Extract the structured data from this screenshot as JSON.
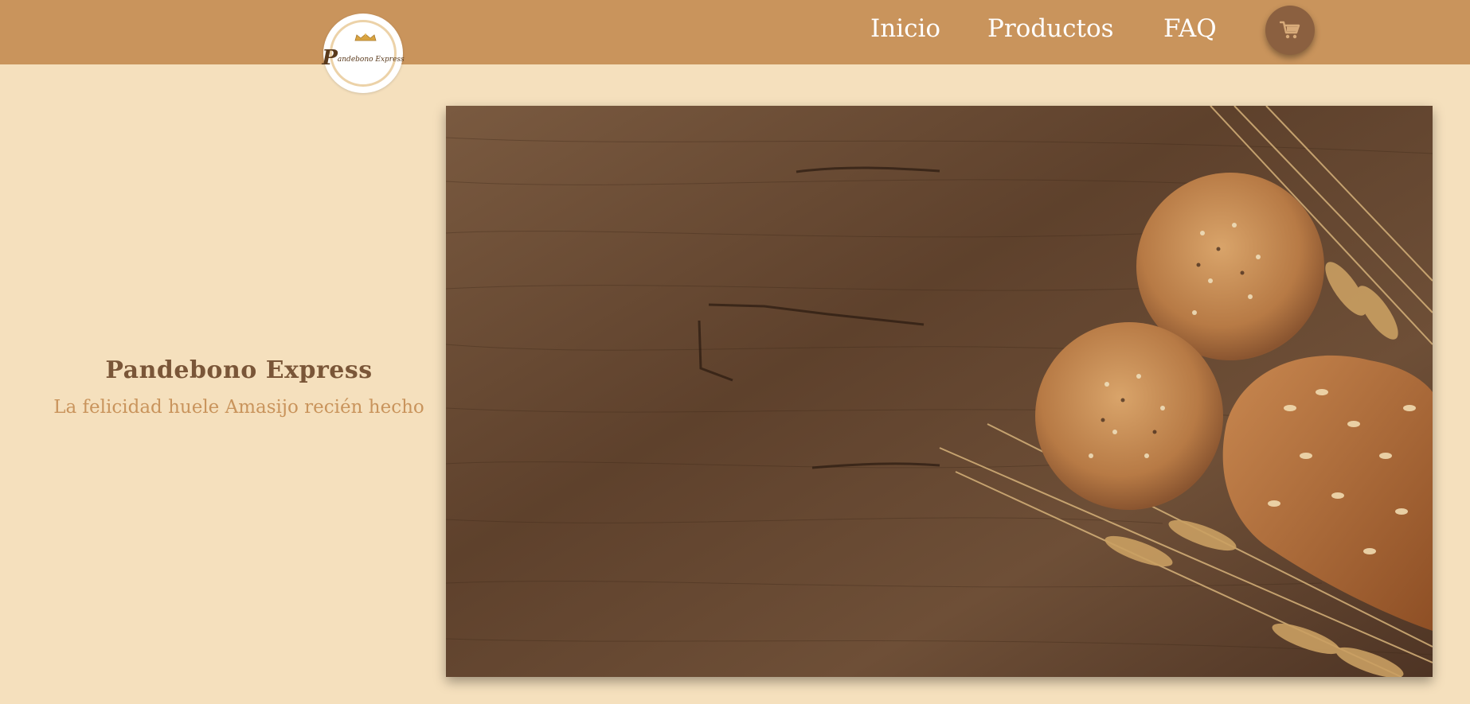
{
  "header": {
    "logo": {
      "text_initial": "P",
      "text_rest": "andebono Express",
      "icon": "crown-icon"
    },
    "nav": [
      {
        "label": "Inicio"
      },
      {
        "label": "Productos"
      },
      {
        "label": "FAQ"
      }
    ],
    "cart": {
      "icon": "cart-icon"
    }
  },
  "hero": {
    "title": "Pandebono Express",
    "subtitle": "La felicidad huele Amasijo recién hecho",
    "image_alt": "bread rolls and wheat on wooden table"
  },
  "colors": {
    "page_bg": "#f5e0bd",
    "header_bg": "#c9945c",
    "title": "#7a5638",
    "subtitle": "#c9945c",
    "cart_bg": "#8b6040"
  }
}
